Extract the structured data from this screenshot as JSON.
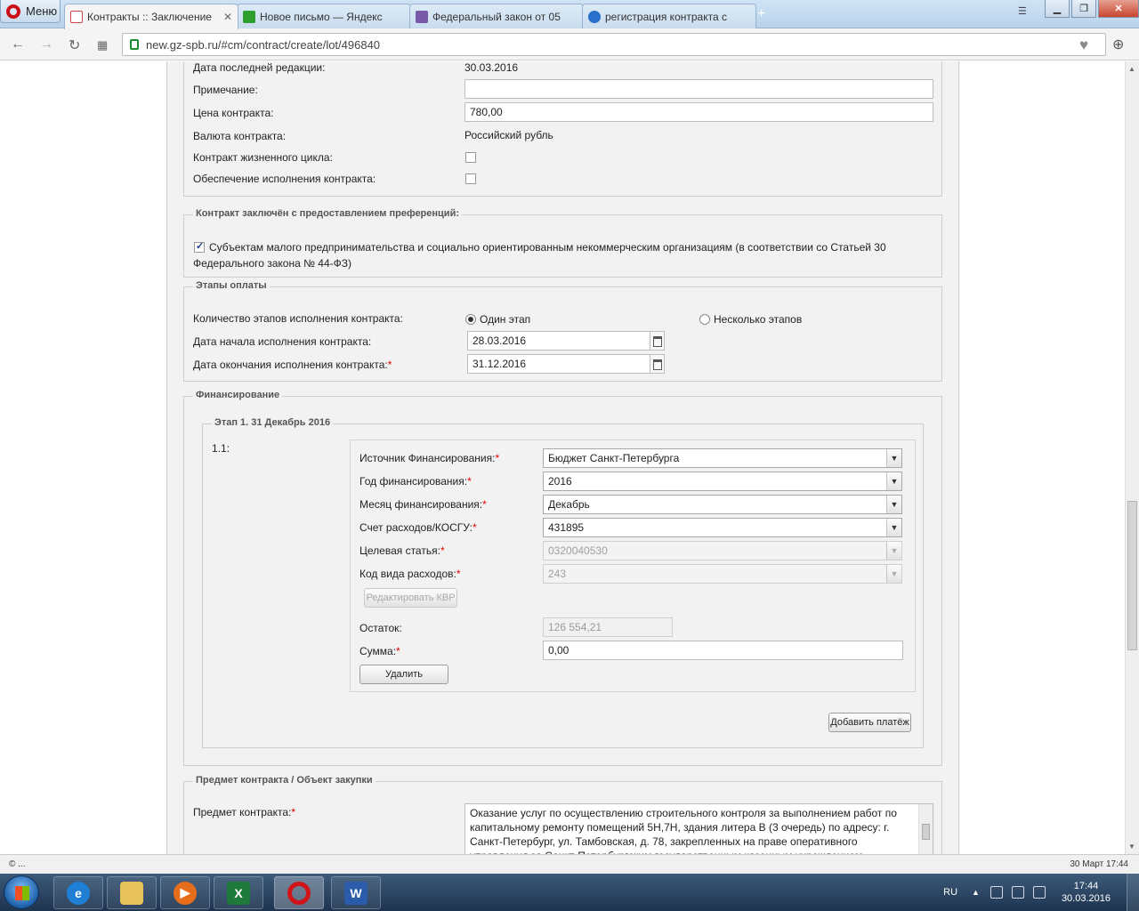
{
  "browser": {
    "menu_label": "Меню",
    "tabs": [
      {
        "title": "Контракты :: Заключение",
        "active": true
      },
      {
        "title": "Новое письмо — Яндекс",
        "active": false
      },
      {
        "title": "Федеральный закон от 05",
        "active": false
      },
      {
        "title": "регистрация контракта с",
        "active": false
      }
    ],
    "new_tab": "+",
    "url": "new.gz-spb.ru/#cm/contract/create/lot/496840"
  },
  "general": {
    "last_edit_label": "Дата последней редакции:",
    "last_edit_value": "30.03.2016",
    "note_label": "Примечание:",
    "note_value": "",
    "price_label": "Цена контракта:",
    "price_value": "780,00",
    "currency_label": "Валюта контракта:",
    "currency_value": "Российский рубль",
    "lifecycle_label": "Контракт жизненного цикла:",
    "lifecycle_checked": false,
    "security_label": "Обеспечение исполнения контракта:",
    "security_checked": false
  },
  "preferences": {
    "legend": "Контракт заключён с предоставлением преференций:",
    "smb_checked": true,
    "smb_line1": "Субъектам малого предпринимательства и социально ориентированным некоммерческим организациям (в соответствии со Статьей 30",
    "smb_line2": "Федерального закона № 44-ФЗ)"
  },
  "payment_stages": {
    "legend": "Этапы оплаты",
    "count_label": "Количество этапов исполнения контракта:",
    "option_one": "Один этап",
    "option_many": "Несколько этапов",
    "selected": "one",
    "start_label": "Дата начала исполнения контракта:",
    "start_value": "28.03.2016",
    "end_label": "Дата окончания исполнения контракта:",
    "end_value": "31.12.2016"
  },
  "financing": {
    "legend": "Финансирование",
    "stage_legend": "Этап 1. 31 Декабрь 2016",
    "row_number": "1.1:",
    "source_label": "Источник Финансирования:",
    "source_value": "Бюджет Санкт-Петербурга",
    "year_label": "Год финансирования:",
    "year_value": "2016",
    "month_label": "Месяц финансирования:",
    "month_value": "Декабрь",
    "account_label": "Счет расходов/КОСГУ:",
    "account_value": "431895",
    "target_label": "Целевая статья:",
    "target_value": "0320040530",
    "expense_code_label": "Код вида расходов:",
    "expense_code_value": "243",
    "edit_kvr_button": "Редактировать КВР",
    "balance_label": "Остаток:",
    "balance_value": "126 554,21",
    "sum_label": "Сумма:",
    "sum_value": "0,00",
    "delete_button": "Удалить",
    "add_payment_button": "Добавить платёж"
  },
  "subject": {
    "legend": "Предмет контракта / Объект закупки",
    "label": "Предмет контракта:",
    "text": "Оказание услуг по осуществлению строительного контроля за выполнением работ по капитальному ремонту помещений 5Н,7Н, здания литера В (3 очередь) по адресу: г. Санкт-Петербург, ул. Тамбовская, д. 78, закрепленных на праве оперативного управления за Санкт-Петербургским государственным казенным учреждением"
  },
  "statusbar": {
    "left": "© ...",
    "right": "30 Март 17:44"
  },
  "taskbar": {
    "lang": "RU",
    "time": "17:44",
    "date": "30.03.2016"
  },
  "colors": {
    "required": "#e00000",
    "opera_red": "#cc0f16",
    "page_bg": "#f2f2f2"
  }
}
